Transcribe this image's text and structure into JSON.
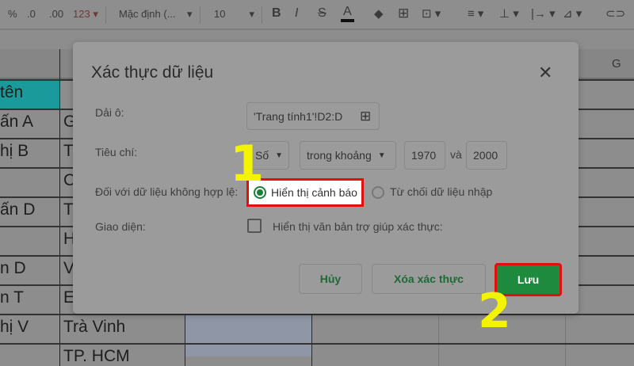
{
  "toolbar": {
    "percent": "%",
    "dec_less": ".0",
    "dec_more": ".00",
    "format": "123",
    "font": "Mặc định (...",
    "font_size": "10",
    "bold": "B",
    "italic": "I",
    "strike": "S",
    "text_color": "A"
  },
  "sheet": {
    "col_g": "G",
    "col_a": [
      "tên",
      "ấn A",
      "hị B",
      "",
      "ấn D",
      "",
      "n D",
      "n T",
      "hị V",
      ""
    ],
    "col_b": [
      "",
      "G",
      "T",
      "C",
      "T",
      "H",
      "V",
      "E",
      "Trà Vinh",
      "TP. HCM"
    ]
  },
  "dialog": {
    "title": "Xác thực dữ liệu",
    "range_label": "Dải ô:",
    "range_value": "'Trang tính1'!D2:D",
    "criteria_label": "Tiêu chí:",
    "criteria_type": "Số",
    "criteria_op": "trong khoảng",
    "min": "1970",
    "and": "và",
    "max": "2000",
    "invalid_label": "Đối với dữ liệu không hợp lệ:",
    "opt_warn": "Hiển thị cảnh báo",
    "opt_reject": "Từ chối dữ liệu nhập",
    "appearance_label": "Giao diện:",
    "help_text": "Hiển thị văn bản trợ giúp xác thực:",
    "cancel": "Hủy",
    "remove": "Xóa xác thực",
    "save": "Lưu"
  },
  "annotations": {
    "step1": "1",
    "step2": "2"
  },
  "colors": {
    "accent": "#1e8a3e",
    "highlight": "#e01010",
    "marker": "#f4f400"
  }
}
